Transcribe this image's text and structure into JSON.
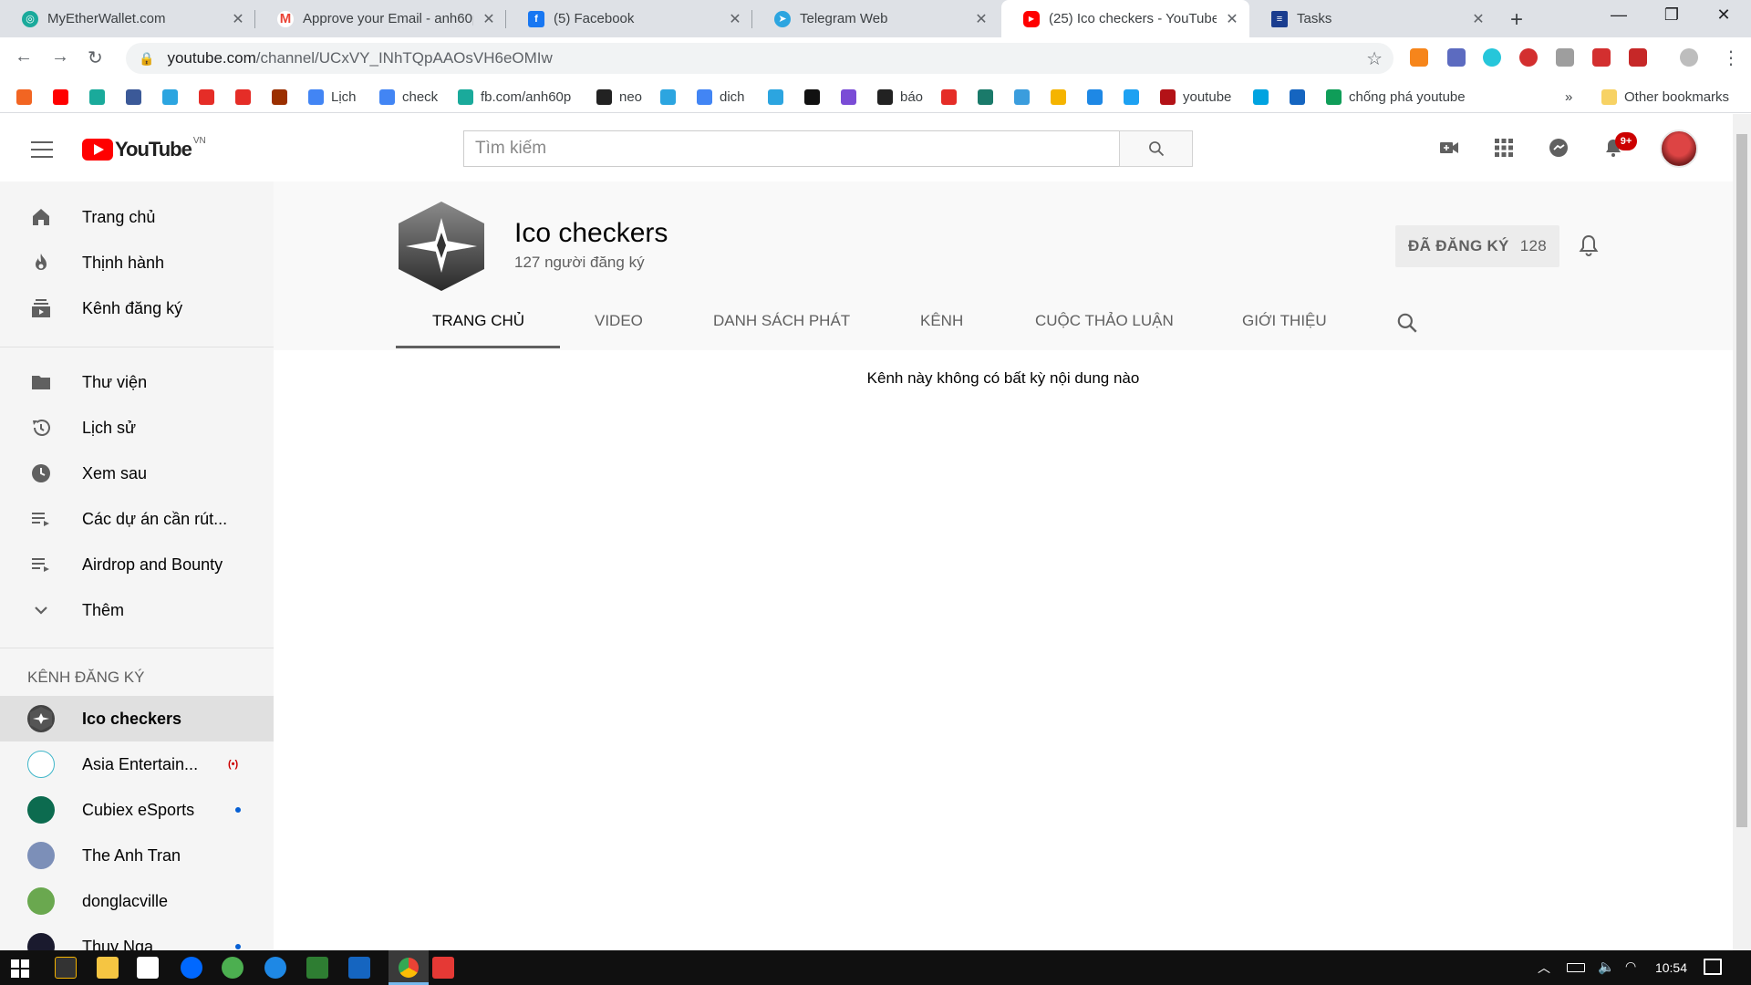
{
  "browser": {
    "tabs": [
      {
        "title": "MyEtherWallet.com",
        "icon": "myetherwallet-icon",
        "color": "#1aaa9b"
      },
      {
        "title": "Approve your Email - anh60p",
        "icon": "gmail-icon",
        "color": "#ea4335"
      },
      {
        "title": "(5) Facebook",
        "icon": "facebook-icon",
        "color": "#1877f2"
      },
      {
        "title": "Telegram Web",
        "icon": "telegram-icon",
        "color": "#2ca5e0"
      },
      {
        "title": "(25) Ico checkers - YouTube",
        "icon": "youtube-icon",
        "color": "#ff0000",
        "active": true
      },
      {
        "title": "Tasks",
        "icon": "tasks-icon",
        "color": "#1a3d8f"
      }
    ],
    "url_host": "youtube.com",
    "url_path": "/channel/UCxVY_INhTQpAAOsVH6eOMIw"
  },
  "bookmarks": [
    {
      "label": "",
      "color": "#f26522"
    },
    {
      "label": "",
      "color": "#ff0000"
    },
    {
      "label": "",
      "color": "#1aaa9b"
    },
    {
      "label": "",
      "color": "#3b5998"
    },
    {
      "label": "",
      "color": "#2ca5e0"
    },
    {
      "label": "",
      "color": "#e52d27"
    },
    {
      "label": "",
      "color": "#e52d27"
    },
    {
      "label": "",
      "color": "#9b2f00"
    },
    {
      "label": "Lịch",
      "color": "#4285f4"
    },
    {
      "label": "check",
      "color": "#4285f4"
    },
    {
      "label": "fb.com/anh60p",
      "color": "#1aaa9b"
    },
    {
      "label": "neo",
      "color": "#222222"
    },
    {
      "label": "",
      "color": "#2ca5e0"
    },
    {
      "label": "dich",
      "color": "#4285f4"
    },
    {
      "label": "",
      "color": "#2ca5e0"
    },
    {
      "label": "",
      "color": "#111111"
    },
    {
      "label": "",
      "color": "#7a4cd6"
    },
    {
      "label": "báo",
      "color": "#222222"
    },
    {
      "label": "",
      "color": "#e52d27"
    },
    {
      "label": "",
      "color": "#1a7a6a"
    },
    {
      "label": "",
      "color": "#3b9ddd"
    },
    {
      "label": "",
      "color": "#f5b400"
    },
    {
      "label": "",
      "color": "#1e88e5"
    },
    {
      "label": "",
      "color": "#1da1f2"
    },
    {
      "label": "youtube",
      "color": "#b31217"
    },
    {
      "label": "",
      "color": "#00a3e0"
    },
    {
      "label": "",
      "color": "#1565c0"
    },
    {
      "label": "chống phá youtube",
      "color": "#0f9d58"
    }
  ],
  "bookmarks_other": "Other bookmarks",
  "youtube": {
    "logo_text": "YouTube",
    "country_code": "VN",
    "search_placeholder": "Tìm kiếm",
    "notif_badge": "9+"
  },
  "sidebar": {
    "main": [
      {
        "label": "Trang chủ",
        "icon": "home-icon"
      },
      {
        "label": "Thịnh hành",
        "icon": "trending-icon"
      },
      {
        "label": "Kênh đăng ký",
        "icon": "subscriptions-icon"
      }
    ],
    "library": [
      {
        "label": "Thư viện",
        "icon": "library-icon"
      },
      {
        "label": "Lịch sử",
        "icon": "history-icon"
      },
      {
        "label": "Xem sau",
        "icon": "watch-later-icon"
      },
      {
        "label": "Các dự án cần rút...",
        "icon": "playlist-icon"
      },
      {
        "label": "Airdrop and Bounty",
        "icon": "playlist-icon"
      },
      {
        "label": "Thêm",
        "icon": "chevron-down-icon"
      }
    ],
    "subscriptions_heading": "KÊNH ĐĂNG KÝ",
    "subscriptions": [
      {
        "label": "Ico checkers",
        "selected": true,
        "status": "",
        "color": "#444444"
      },
      {
        "label": "Asia Entertain...",
        "status": "live",
        "color": "#3fb6c9"
      },
      {
        "label": "Cubiex eSports",
        "status": "new",
        "color": "#0c6b4f"
      },
      {
        "label": "The Anh Tran",
        "status": "",
        "color": "#7c8fb8"
      },
      {
        "label": "donglacville",
        "status": "",
        "color": "#6aa84f"
      },
      {
        "label": "Thuy Nga",
        "status": "new",
        "color": "#1a1a2e"
      }
    ],
    "live_glyph": "(•)"
  },
  "channel": {
    "name": "Ico checkers",
    "subscribers": "127 người đăng ký",
    "subscribe_label": "ĐÃ ĐĂNG KÝ",
    "subscribe_count": "128",
    "tabs": [
      "TRANG CHỦ",
      "VIDEO",
      "DANH SÁCH PHÁT",
      "KÊNH",
      "CUỘC THẢO LUẬN",
      "GIỚI THIỆU"
    ],
    "active_tab": "TRANG CHỦ",
    "empty_message": "Kênh này không có bất kỳ nội dung nào"
  },
  "taskbar": {
    "clock": "10:54"
  }
}
